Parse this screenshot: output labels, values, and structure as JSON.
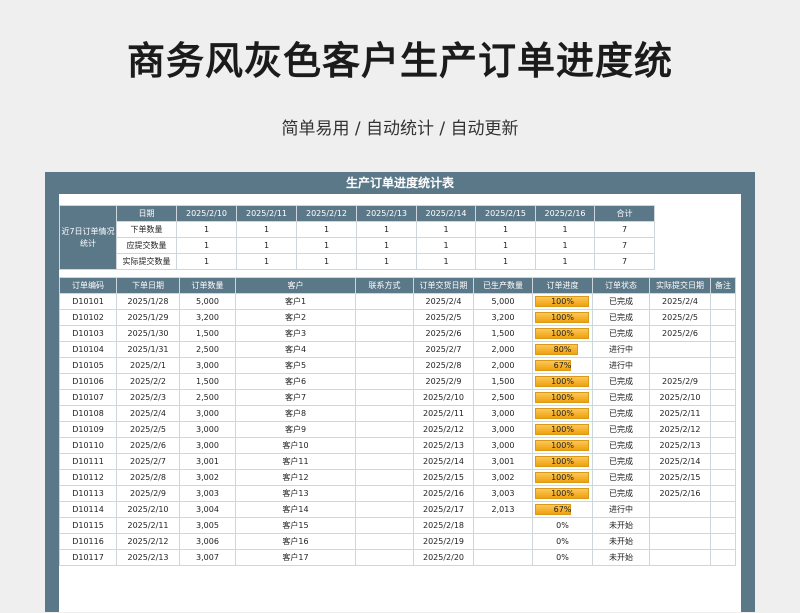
{
  "page": {
    "title": "商务风灰色客户生产订单进度统",
    "subtitle": "简单易用 / 自动统计 / 自动更新"
  },
  "sheet": {
    "title": "生产订单进度统计表",
    "summary": {
      "label": "近7日订单情况统计",
      "header": [
        "日期",
        "2025/2/10",
        "2025/2/11",
        "2025/2/12",
        "2025/2/13",
        "2025/2/14",
        "2025/2/15",
        "2025/2/16",
        "合计"
      ],
      "rows": [
        [
          "下单数量",
          "1",
          "1",
          "1",
          "1",
          "1",
          "1",
          "1",
          "7"
        ],
        [
          "应提交数量",
          "1",
          "1",
          "1",
          "1",
          "1",
          "1",
          "1",
          "7"
        ],
        [
          "实际提交数量",
          "1",
          "1",
          "1",
          "1",
          "1",
          "1",
          "1",
          "7"
        ]
      ]
    },
    "orders": {
      "columns": [
        "订单编码",
        "下单日期",
        "订单数量",
        "客户",
        "联系方式",
        "订单交货日期",
        "已生产数量",
        "订单进度",
        "订单状态",
        "实际提交日期",
        "备注"
      ],
      "rows": [
        {
          "id": "D10101",
          "date": "2025/1/28",
          "qty": "5,000",
          "customer": "客户1",
          "contact": "",
          "due": "2025/2/4",
          "produced": "5,000",
          "progress": "100%",
          "pct": 100,
          "status": "已完成",
          "submitted": "2025/2/4",
          "note": ""
        },
        {
          "id": "D10102",
          "date": "2025/1/29",
          "qty": "3,200",
          "customer": "客户2",
          "contact": "",
          "due": "2025/2/5",
          "produced": "3,200",
          "progress": "100%",
          "pct": 100,
          "status": "已完成",
          "submitted": "2025/2/5",
          "note": ""
        },
        {
          "id": "D10103",
          "date": "2025/1/30",
          "qty": "1,500",
          "customer": "客户3",
          "contact": "",
          "due": "2025/2/6",
          "produced": "1,500",
          "progress": "100%",
          "pct": 100,
          "status": "已完成",
          "submitted": "2025/2/6",
          "note": ""
        },
        {
          "id": "D10104",
          "date": "2025/1/31",
          "qty": "2,500",
          "customer": "客户4",
          "contact": "",
          "due": "2025/2/7",
          "produced": "2,000",
          "progress": "80%",
          "pct": 80,
          "status": "进行中",
          "submitted": "",
          "note": ""
        },
        {
          "id": "D10105",
          "date": "2025/2/1",
          "qty": "3,000",
          "customer": "客户5",
          "contact": "",
          "due": "2025/2/8",
          "produced": "2,000",
          "progress": "67%",
          "pct": 67,
          "status": "进行中",
          "submitted": "",
          "note": ""
        },
        {
          "id": "D10106",
          "date": "2025/2/2",
          "qty": "1,500",
          "customer": "客户6",
          "contact": "",
          "due": "2025/2/9",
          "produced": "1,500",
          "progress": "100%",
          "pct": 100,
          "status": "已完成",
          "submitted": "2025/2/9",
          "note": ""
        },
        {
          "id": "D10107",
          "date": "2025/2/3",
          "qty": "2,500",
          "customer": "客户7",
          "contact": "",
          "due": "2025/2/10",
          "produced": "2,500",
          "progress": "100%",
          "pct": 100,
          "status": "已完成",
          "submitted": "2025/2/10",
          "note": ""
        },
        {
          "id": "D10108",
          "date": "2025/2/4",
          "qty": "3,000",
          "customer": "客户8",
          "contact": "",
          "due": "2025/2/11",
          "produced": "3,000",
          "progress": "100%",
          "pct": 100,
          "status": "已完成",
          "submitted": "2025/2/11",
          "note": ""
        },
        {
          "id": "D10109",
          "date": "2025/2/5",
          "qty": "3,000",
          "customer": "客户9",
          "contact": "",
          "due": "2025/2/12",
          "produced": "3,000",
          "progress": "100%",
          "pct": 100,
          "status": "已完成",
          "submitted": "2025/2/12",
          "note": ""
        },
        {
          "id": "D10110",
          "date": "2025/2/6",
          "qty": "3,000",
          "customer": "客户10",
          "contact": "",
          "due": "2025/2/13",
          "produced": "3,000",
          "progress": "100%",
          "pct": 100,
          "status": "已完成",
          "submitted": "2025/2/13",
          "note": ""
        },
        {
          "id": "D10111",
          "date": "2025/2/7",
          "qty": "3,001",
          "customer": "客户11",
          "contact": "",
          "due": "2025/2/14",
          "produced": "3,001",
          "progress": "100%",
          "pct": 100,
          "status": "已完成",
          "submitted": "2025/2/14",
          "note": ""
        },
        {
          "id": "D10112",
          "date": "2025/2/8",
          "qty": "3,002",
          "customer": "客户12",
          "contact": "",
          "due": "2025/2/15",
          "produced": "3,002",
          "progress": "100%",
          "pct": 100,
          "status": "已完成",
          "submitted": "2025/2/15",
          "note": ""
        },
        {
          "id": "D10113",
          "date": "2025/2/9",
          "qty": "3,003",
          "customer": "客户13",
          "contact": "",
          "due": "2025/2/16",
          "produced": "3,003",
          "progress": "100%",
          "pct": 100,
          "status": "已完成",
          "submitted": "2025/2/16",
          "note": ""
        },
        {
          "id": "D10114",
          "date": "2025/2/10",
          "qty": "3,004",
          "customer": "客户14",
          "contact": "",
          "due": "2025/2/17",
          "produced": "2,013",
          "progress": "67%",
          "pct": 67,
          "status": "进行中",
          "submitted": "",
          "note": ""
        },
        {
          "id": "D10115",
          "date": "2025/2/11",
          "qty": "3,005",
          "customer": "客户15",
          "contact": "",
          "due": "2025/2/18",
          "produced": "",
          "progress": "0%",
          "pct": 0,
          "status": "未开始",
          "submitted": "",
          "note": ""
        },
        {
          "id": "D10116",
          "date": "2025/2/12",
          "qty": "3,006",
          "customer": "客户16",
          "contact": "",
          "due": "2025/2/19",
          "produced": "",
          "progress": "0%",
          "pct": 0,
          "status": "未开始",
          "submitted": "",
          "note": ""
        },
        {
          "id": "D10117",
          "date": "2025/2/13",
          "qty": "3,007",
          "customer": "客户17",
          "contact": "",
          "due": "2025/2/20",
          "produced": "",
          "progress": "0%",
          "pct": 0,
          "status": "未开始",
          "submitted": "",
          "note": ""
        }
      ]
    }
  }
}
